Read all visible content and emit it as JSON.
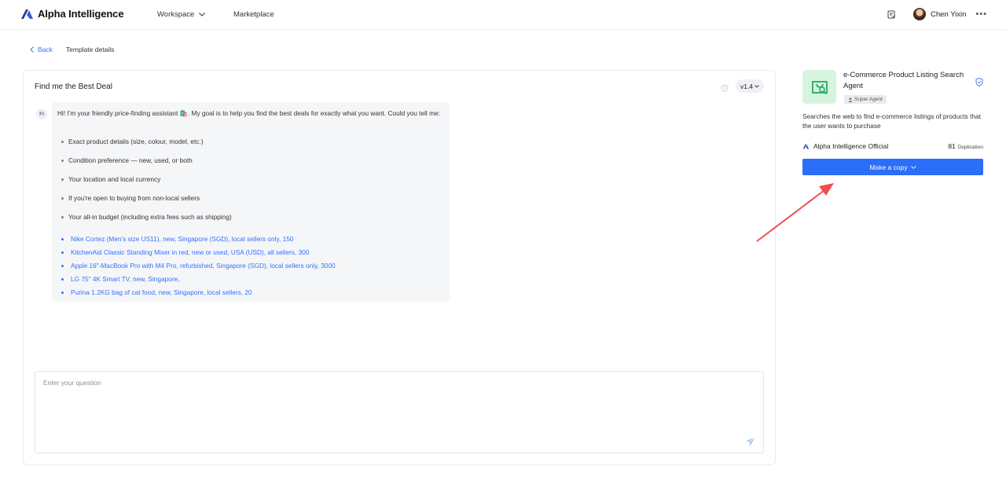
{
  "header": {
    "brand": "Alpha Intelligence",
    "nav": [
      {
        "label": "Workspace",
        "has_dropdown": true
      },
      {
        "label": "Marketplace",
        "has_dropdown": false
      }
    ],
    "user_name": "Chen Yixin"
  },
  "breadcrumb": {
    "back_label": "Back",
    "current": "Template details"
  },
  "chat": {
    "title": "Find me the Best Deal",
    "version": "v1.4",
    "bot_initials": "FI",
    "intro": "Hi! I'm your friendly price-finding assistant 🛍️. My goal is to help you find the best deals for exactly what you want. Could you tell me:",
    "questions": [
      "Exact product details (size, colour, model, etc.)",
      "Condition preference — new, used, or both",
      "Your location and local currency",
      "If you're open to buying from non-local sellers",
      "Your all-in budget (including extra fees such as shipping)"
    ],
    "examples": [
      "Nike Cortez (Men's size US11), new, Singapore (SGD), local sellers only, 150",
      "KitchenAid Classic Standing Mixer in red, new or used, USA (USD), all sellers, 300",
      "Apple 16\"-MacBook Pro with M4 Pro, refurbished, Singapore (SGD), local sellers only, 3000",
      "LG 75\" 4K Smart TV, new, Singapore,",
      "Purina 1.2KG bag of cat food, new, Singapore, local sellers, 20"
    ],
    "input_placeholder": "Enter your question"
  },
  "agent": {
    "name": "e-Commerce Product Listing Search Agent",
    "badge": "Super Agent",
    "description": "Searches the web to find e-commerce listings of products that the user wants to purchase",
    "owner": "Alpha Intelligence Official",
    "duplication_count": "81",
    "duplication_label": "Duplication",
    "copy_button": "Make a copy",
    "icon_color": "#d7f4df",
    "icon_stroke": "#35b070"
  },
  "colors": {
    "accent": "#2b6ef8",
    "link": "#3370ff",
    "annotation_arrow": "#ef4f4f"
  },
  "icons": {
    "logo": "alpha-logo-icon",
    "history": "history-icon",
    "send": "send-icon",
    "verified": "verified-shield-icon",
    "more": "more-horizontal-icon",
    "task": "task-list-icon"
  }
}
